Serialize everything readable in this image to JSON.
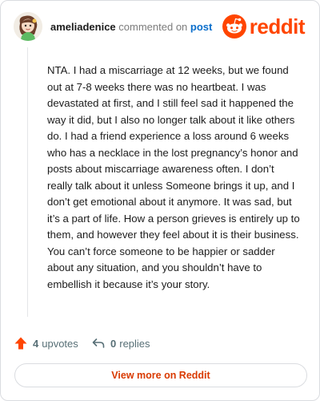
{
  "header": {
    "username": "ameliadenice",
    "verb": "commented on",
    "post_link": "post",
    "logo_text": "reddit",
    "avatar_icon": "snoo-avatar-icon",
    "logo_icon": "reddit-snoo-icon"
  },
  "comment": {
    "text": "NTA. I had a miscarriage at 12 weeks, but we found out at 7-8 weeks there was no heartbeat. I was devastated at first, and I still feel sad it happened the way it did, but I also no longer talk about it like others do. I had a friend experience a loss around 6 weeks who has a necklace in the lost pregnancy’s honor and posts about miscarriage awareness often. I don’t really talk about it unless Someone brings it up, and I don’t get emotional about it anymore. It was sad, but it’s a part of life. How a person grieves is entirely up to them, and however they feel about it is their business. You can’t force someone to be happier or sadder about any situation, and you shouldn’t have to embellish it because it’s your story."
  },
  "actions": {
    "upvotes_count": "4",
    "upvotes_label": "upvotes",
    "upvote_icon": "upvote-arrow-icon",
    "replies_count": "0",
    "replies_label": "replies",
    "reply_icon": "reply-arrow-icon"
  },
  "footer": {
    "view_more_label": "View more on Reddit"
  },
  "colors": {
    "brand": "#ff4500",
    "link": "#0a6ecb",
    "muted": "#576f76",
    "view_more_text": "#d93a00"
  }
}
